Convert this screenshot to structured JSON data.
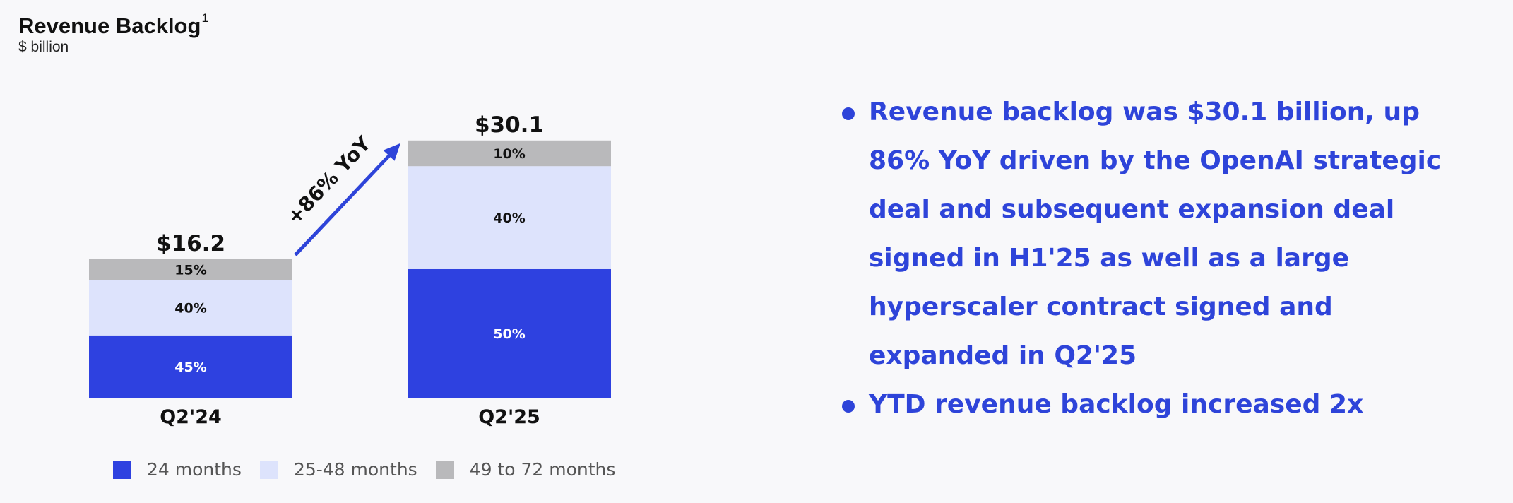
{
  "header": {
    "title": "Revenue Backlog",
    "footnote": "1",
    "subtitle": "$ billion"
  },
  "colors": {
    "dark_blue": "#2e41e0",
    "light_blue": "#dde3fc",
    "gray": "#b9b9bb",
    "accent": "#2e44d9"
  },
  "chart_data": {
    "type": "bar",
    "stacked": true,
    "categories": [
      "Q2'24",
      "Q2'25"
    ],
    "totals": [
      16.2,
      30.1
    ],
    "total_labels": [
      "$16.2",
      "$30.1"
    ],
    "series": [
      {
        "name": "24 months",
        "values": [
          45,
          50
        ],
        "labels": [
          "45%",
          "50%"
        ],
        "color": "#2e41e0"
      },
      {
        "name": "25-48 months",
        "values": [
          40,
          40
        ],
        "labels": [
          "40%",
          "40%"
        ],
        "color": "#dde3fc"
      },
      {
        "name": "49 to 72 months",
        "values": [
          15,
          10
        ],
        "labels": [
          "15%",
          "10%"
        ],
        "color": "#b9b9bb"
      }
    ],
    "annotation": "+86% YoY",
    "legend_position": "bottom"
  },
  "bullets": [
    "Revenue backlog was $30.1 billion, up 86% YoY driven by the OpenAI strategic deal  and subsequent expansion deal signed in H1'25 as well as a large hyperscaler contract signed and expanded in Q2'25",
    "YTD revenue backlog increased 2x"
  ]
}
